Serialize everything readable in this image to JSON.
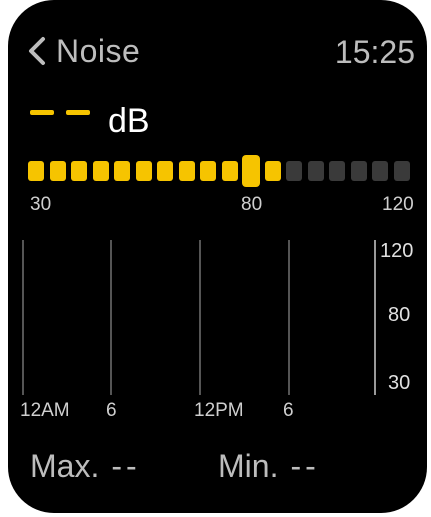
{
  "header": {
    "back_label": "Noise",
    "time": "15:25"
  },
  "reading": {
    "value": "--",
    "unit": "dB",
    "value_color": "#f6c400"
  },
  "meter": {
    "scale_min_label": "30",
    "scale_mid_label": "80",
    "scale_max_label": "120",
    "min": 30,
    "max": 120,
    "total_segments": 18,
    "active_segments": 12,
    "marker_value": 80,
    "active_color": "#f6c400",
    "inactive_color": "#3a3a3a"
  },
  "history_chart": {
    "y_labels": [
      "120",
      "80",
      "30"
    ],
    "x_labels": [
      "12AM",
      "6",
      "12PM",
      "6"
    ]
  },
  "stats": {
    "max_label": "Max.",
    "max_value": "--",
    "min_label": "Min.",
    "min_value": "--"
  },
  "icons": {
    "back": "chevron-left-icon"
  }
}
